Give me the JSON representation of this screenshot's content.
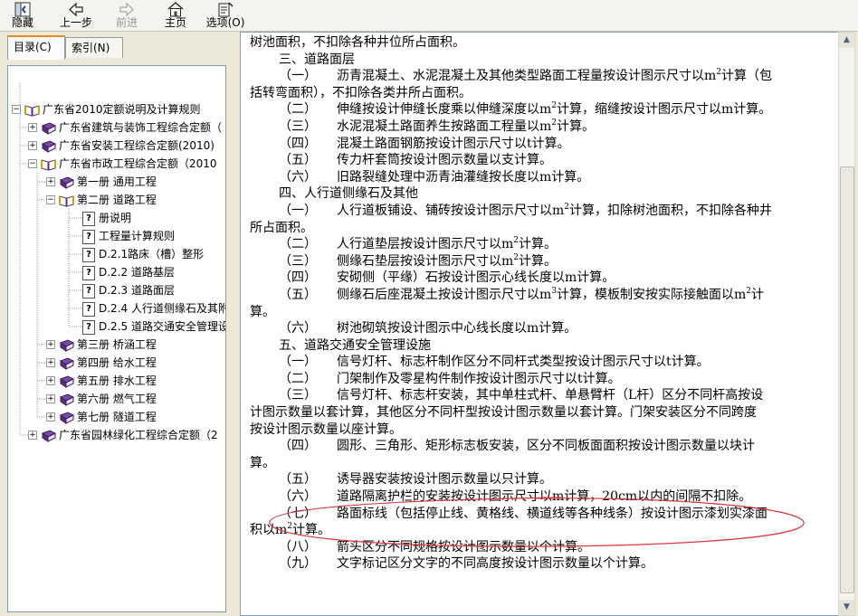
{
  "toolbar": {
    "hide_label": "隐藏",
    "back_label": "上一步",
    "forward_label": "前进",
    "home_label": "主页",
    "options_label": "选项(O)"
  },
  "tabs": {
    "contents": "目录(C)",
    "index": "索引(N)"
  },
  "tree": {
    "root": "广东省2010定额说明及计算规则",
    "n1": "广东省建筑与装饰工程综合定额（",
    "n2": "广东省安装工程综合定额(2010)",
    "n3": "广东省市政工程综合定额（2010",
    "n3_1": "第一册 通用工程",
    "n3_2": "第二册 道路工程",
    "n3_2_1": "册说明",
    "n3_2_2": "工程量计算规则",
    "n3_2_3": "D.2.1路床（槽）整形",
    "n3_2_4": "D.2.2 道路基层",
    "n3_2_5": "D.2.3  道路面层",
    "n3_2_6": "D.2.4  人行道侧缘石及其附",
    "n3_2_7": "D.2.5  道路交通安全管理设",
    "n3_3": "第三册 桥涵工程",
    "n3_4": "第四册 给水工程",
    "n3_5": "第五册 排水工程",
    "n3_6": "第六册 燃气工程",
    "n3_7": "第七册 隧道工程",
    "n4": "广东省园林绿化工程综合定额（2"
  },
  "content": {
    "l0": "树池面积，不扣除各种井位所占面积。",
    "h3": "三、道路面层",
    "s3_1_num": "（一）",
    "s3_1a": "沥青混凝土、水泥混凝土及其他类型路面工程量按设计图示尺寸以m",
    "s3_1b": "计算（包",
    "s3_1c": "括转弯面积），不扣除各类井所占面积。",
    "s3_2_num": "（二）",
    "s3_2a": "伸缝按设计伸缝长度乘以伸缝深度以m",
    "s3_2b": "计算，缩缝按设计图示尺寸以m计算。",
    "s3_3_num": "（三）",
    "s3_3a": "水泥混凝土路面养生按路面工程量以m",
    "s3_3b": "计算。",
    "s3_4_num": "（四）",
    "s3_4": "混凝土路面钢筋按设计图示尺寸以t计算。",
    "s3_5_num": "（五）",
    "s3_5": "传力杆套筒按设计图示数量以支计算。",
    "s3_6_num": "（六）",
    "s3_6": "旧路裂缝处理中沥青油灌缝按长度以m计算。",
    "h4": "四、人行道侧缘石及其他",
    "s4_1_num": "（一）",
    "s4_1a": "人行道板铺设、铺砖按设计图示尺寸以m",
    "s4_1b": "计算，扣除树池面积，不扣除各种井",
    "s4_1c": "所占面积。",
    "s4_2_num": "（二）",
    "s4_2a": "人行道垫层按设计图示尺寸以m",
    "s4_2b": "计算。",
    "s4_3_num": "（三）",
    "s4_3a": "侧缘石垫层按设计图示尺寸以m",
    "s4_3b": "计算。",
    "s4_4_num": "（四）",
    "s4_4": "安砌侧（平缘）石按设计图示心线长度以m计算。",
    "s4_5_num": "（五）",
    "s4_5a": "侧缘石后座混凝土按设计图示尺寸以m",
    "s4_5b": "计算，模板制安按实际接触面以m",
    "s4_5c": "计",
    "s4_5d": "算。",
    "s4_6_num": "（六）",
    "s4_6": "树池砌筑按设计图示中心线长度以m计算。",
    "h5": "五、道路交通安全管理设施",
    "s5_1_num": "（一）",
    "s5_1": "信号灯杆、标志杆制作区分不同杆式类型按设计图示尺寸以t计算。",
    "s5_2_num": "（二）",
    "s5_2": "门架制作及零星构件制作按设计图示尺寸以t计算。",
    "s5_3_num": "（三）",
    "s5_3a": "信号灯杆、标志杆安装，其中单柱式杆、单悬臂杆（L杆）区分不同杆高按设",
    "s5_3b": "计图示数量以套计算，其他区分不同杆型按设计图示数量以套计算。门架安装区分不同跨度",
    "s5_3c": "按设计图示数量以座计算。",
    "s5_4_num": "（四）",
    "s5_4a": "圆形、三角形、矩形标志板安装，区分不同板面面积按设计图示数量以块计",
    "s5_4b": "算。",
    "s5_5_num": "（五）",
    "s5_5": "诱导器安装按设计图示数量以只计算。",
    "s5_6_num": "（六）",
    "s5_6": "道路隔离护栏的安装按设计图示尺寸以m计算，20cm以内的间隔不扣除。",
    "s5_7_num": "（七）",
    "s5_7a": "路面标线（包括停止线、黄格线、横道线等各种线条）按设计图示漆划实漆面",
    "s5_7b": "积以m",
    "s5_7c": "计算。",
    "s5_8_num": "（八）",
    "s5_8": "箭头区分不同规格按设计图示数量以个计算。",
    "s5_9_num": "（九）",
    "s5_9": "文字标记区分文字的不同高度按设计图示数量以个计算。",
    "sup2": "2",
    "sup3": "3"
  },
  "colors": {
    "annotation_ellipse": "#d9363e",
    "book_purple": "#5b2c83",
    "active_tab_accent": "#e68b2c"
  }
}
